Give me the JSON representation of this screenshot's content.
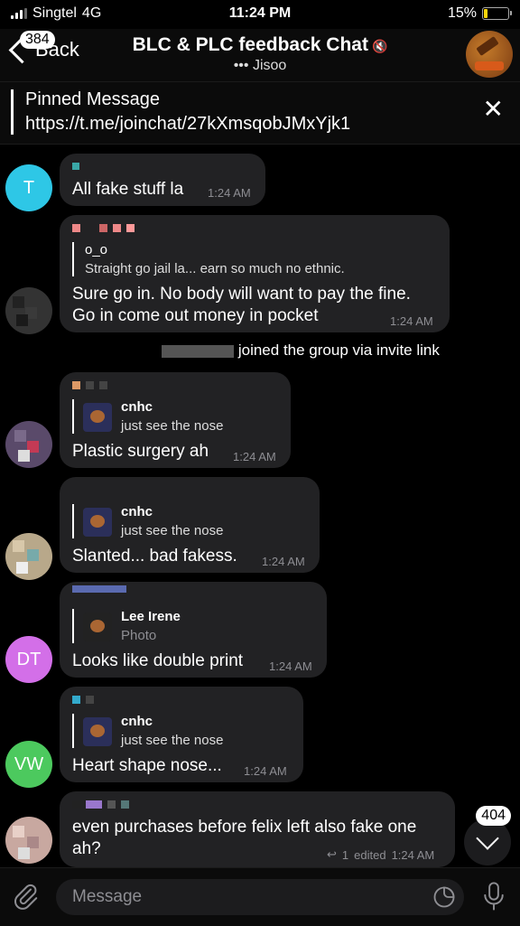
{
  "status_bar": {
    "carrier": "Singtel",
    "network": "4G",
    "time": "11:24 PM",
    "battery": "15%"
  },
  "header": {
    "back_label": "Back",
    "unread_count": "384",
    "title": "BLC & PLC feedback Chat",
    "subtitle": "••• Jisoo"
  },
  "pinned": {
    "title": "Pinned Message",
    "text": "https://t.me/joinchat/27kXmsqobJMxYjk1"
  },
  "messages": [
    {
      "text": "All fake stuff la",
      "time": "1:24 AM",
      "avatar_letter": "T"
    },
    {
      "reply_name": "o_o",
      "reply_text": "Straight go jail la... earn so much no ethnic.",
      "text_line1": "Sure go in. No body will want to pay the fine.",
      "text_line2": "Go in come out money in pocket",
      "time": "1:24 AM"
    },
    {
      "service": "joined the group via invite link"
    },
    {
      "reply_name": "cnhc",
      "reply_text": "just see the nose",
      "text": "Plastic surgery ah",
      "time": "1:24 AM"
    },
    {
      "reply_name": "cnhc",
      "reply_text": "just see the nose",
      "text": "Slanted... bad fakess.",
      "time": "1:24 AM"
    },
    {
      "reply_name": "Lee Irene",
      "reply_text": "Photo",
      "text": "Looks like double print",
      "time": "1:24 AM",
      "avatar_letter": "DT"
    },
    {
      "reply_name": "cnhc",
      "reply_text": "just see the nose",
      "text": "Heart shape nose...",
      "time": "1:24 AM",
      "avatar_letter": "VW"
    },
    {
      "text_line1": "even purchases before felix left also fake one",
      "text_line2": "ah?",
      "reply_count": "1",
      "edited": "edited",
      "time": "1:24 AM"
    }
  ],
  "scroll_badge": "404",
  "input": {
    "placeholder": "Message"
  },
  "colors": {
    "t_avatar": "#2ec7e6",
    "dt_avatar": "#d36fe8",
    "vw_avatar": "#4cc95e",
    "bubble": "#222224"
  }
}
